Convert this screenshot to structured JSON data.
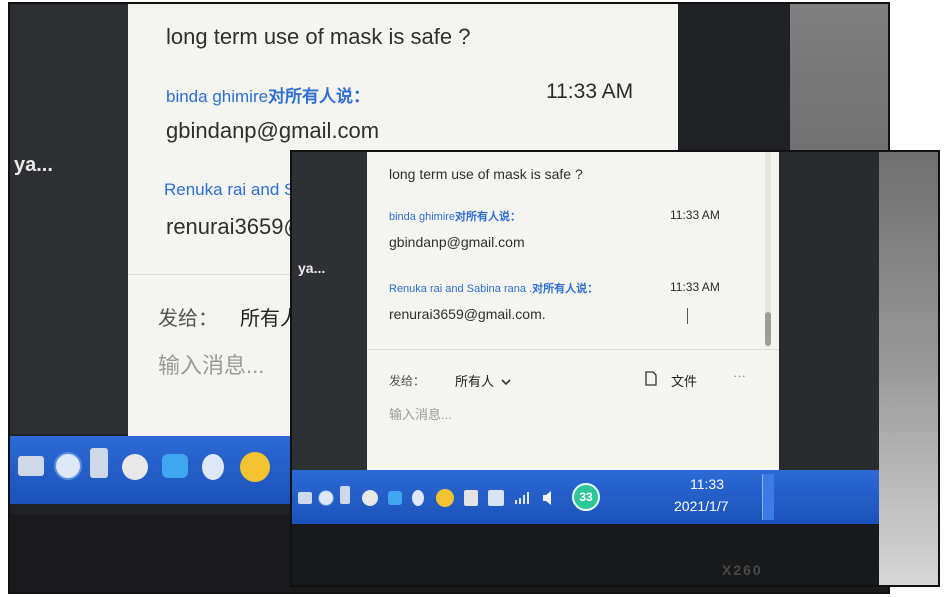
{
  "messages": [
    {
      "text": "long term use of mask is safe ?"
    },
    {
      "sender": "binda ghimire",
      "suffix": "对所有人说：",
      "time": "11:33 AM",
      "text": "gbindanp@gmail.com"
    },
    {
      "sender": "Renuka rai and Sabina rana .",
      "sender_truncated": "Renuka rai and S",
      "suffix": "对所有人说：",
      "time": "11:33 AM",
      "text": "renurai3659@gmail.com.",
      "text_truncated": "renurai3659@"
    }
  ],
  "side_name": "ya...",
  "compose": {
    "to_label": "发给：",
    "to_value": "所有人",
    "to_value_truncated": "所有人",
    "file_label": "文件",
    "more_label": "···",
    "placeholder": "输入消息..."
  },
  "taskbar": {
    "badge": "33",
    "clock_time": "11:33",
    "clock_date": "2021/1/7"
  },
  "bezel_label": "X260",
  "colors": {
    "sender_blue": "#2f6fd3",
    "taskbar_blue": "#1f5cc7",
    "chat_bg": "#f4f4f1"
  }
}
